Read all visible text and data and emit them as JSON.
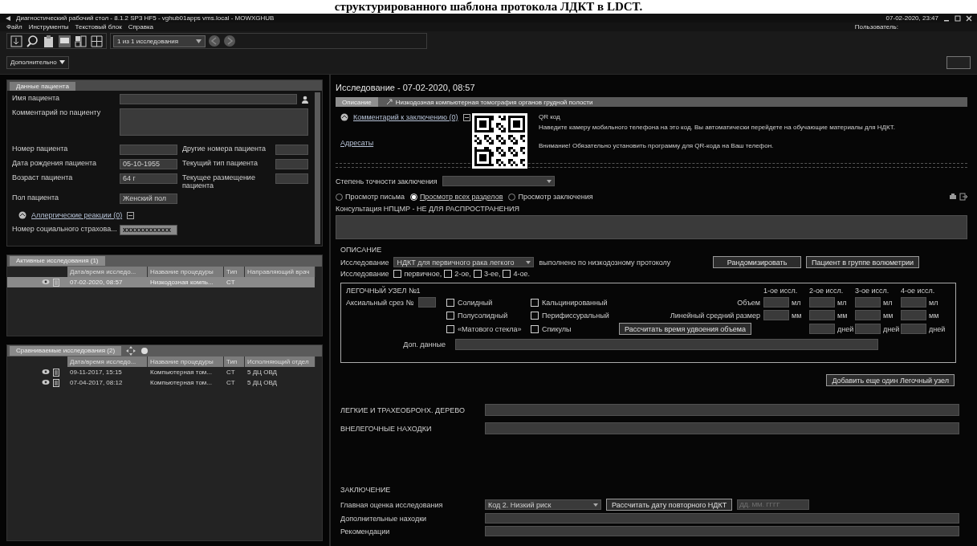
{
  "caption": "структурированного шаблона протокола ЛДКТ в LDCT.",
  "window": {
    "title": "Диагностический рабочий стол - 8.1.2 SP3 HF5 - vghub01apps vms.local - MOWXGHUB",
    "datetime": "07-02-2020, 23:47",
    "user_label": "Пользователь:"
  },
  "menu": [
    "Файл",
    "Инструменты",
    "Текстовый блок",
    "Справка"
  ],
  "toolbar": {
    "study_selector": "1 из 1 исследования",
    "more_button": "Дополнительно"
  },
  "patient": {
    "tab": "Данные пациента",
    "rows": [
      {
        "kind": "wide",
        "label": "Имя пациента"
      },
      {
        "kind": "tall",
        "label": "Комментарий по пациенту"
      },
      {
        "kind": "pair",
        "cells": [
          {
            "label": "Номер пациента"
          },
          {
            "label": "Другие номера пациента"
          }
        ]
      },
      {
        "kind": "pair",
        "cells": [
          {
            "label": "Дата рождения пациента",
            "value": "05-10-1955"
          },
          {
            "label": "Текущий тип пациента"
          }
        ]
      },
      {
        "kind": "pair",
        "cells": [
          {
            "label": "Возраст пациента",
            "value": "64 г"
          },
          {
            "label": "Текущее размещение пациента"
          }
        ]
      },
      {
        "kind": "single",
        "label": "Пол пациента",
        "value": "Женский пол"
      },
      {
        "kind": "link",
        "label": "Аллергические реакции (0)"
      },
      {
        "kind": "highlight",
        "label": "Номер социального страхова...",
        "value": "xxxxxxxxxxxx"
      }
    ]
  },
  "active_studies": {
    "title": "Активные исследования (1)",
    "columns": [
      "Дата/время исследо...",
      "Название процедуры",
      "Тип",
      "Направляющий врач"
    ],
    "rows": [
      {
        "selected": true,
        "cells": [
          "07-02-2020, 08:57",
          "Низкодозная компь...",
          "CT",
          ""
        ]
      }
    ]
  },
  "compared_studies": {
    "title": "Сравниваемые исследования (2)",
    "columns": [
      "Дата/время исследо...",
      "Название процедуры",
      "Тип",
      "Исполняющий отдел"
    ],
    "rows": [
      {
        "selected": false,
        "cells": [
          "09-11-2017, 15:15",
          "Компьютерная том...",
          "CT",
          "5 ДЦ ОВД"
        ]
      },
      {
        "selected": false,
        "cells": [
          "07-04-2017, 08:12",
          "Компьютерная том...",
          "CT",
          "5 ДЦ ОВД"
        ]
      }
    ]
  },
  "exam": {
    "title": "Исследование - 07-02-2020, 08:57",
    "tabs": [
      {
        "label": "Описание",
        "selected": true
      },
      {
        "label": "Низкодозная компьютерная томография органов грудной полости",
        "selected": false
      }
    ],
    "comment_link": "Комментарий к заключению (0)",
    "recipients_link": "Адресаты",
    "qr": {
      "title": "QR код",
      "text": "Наведите камеру мобильного телефона на это код. Вы автоматически перейдете на обучающие материалы для НДКТ.",
      "warning": "Внимание! Обязательно установить программу для QR-кода на Ваш телефон."
    },
    "accuracy_label": "Степень точности заключения",
    "view_options": [
      {
        "label": "Просмотр письма",
        "selected": false
      },
      {
        "label": "Просмотр всех разделов",
        "selected": true
      },
      {
        "label": "Просмотр заключения",
        "selected": false
      }
    ],
    "consult_label": "Консультация НПЦМР - НЕ ДЛЯ РАСПРОСТРАНЕНИЯ",
    "description": {
      "heading": "ОПИСАНИЕ",
      "study_label": "Исследование",
      "study_type": "НДКТ для первичного рака легкого",
      "protocol_text": "выполнено по низкодозному протоколу",
      "buttons": [
        "Рандомизировать",
        "Пациент в группе волюметрии"
      ],
      "order_label": "Исследование",
      "order_options": [
        {
          "label": "первичное,",
          "checked": false
        },
        {
          "label": "2-ое,",
          "checked": false
        },
        {
          "label": "3-ее,",
          "checked": false
        },
        {
          "label": "4-ое.",
          "checked": false
        }
      ]
    },
    "nodule": {
      "title": "ЛЕГОЧНЫЙ УЗЕЛ №1",
      "study_columns": [
        "1-ое иссл.",
        "2-ое иссл.",
        "3-ое иссл.",
        "4-ое иссл."
      ],
      "slice_label": "Аксиальный срез №",
      "types": [
        {
          "label": "Солидный",
          "checked": false
        },
        {
          "label": "Кальцинированный",
          "checked": false
        },
        {
          "label": "Полусолидный",
          "checked": false
        },
        {
          "label": "Перифиссуральный",
          "checked": false
        },
        {
          "label": "«Матового стекла»",
          "checked": false
        },
        {
          "label": "Спикулы",
          "checked": false
        }
      ],
      "volume_label": "Объем",
      "volume_units": [
        "мл",
        "мл",
        "мл",
        "мл"
      ],
      "size_label": "Линейный средний размер",
      "size_units": [
        "мм",
        "мм",
        "мм",
        "мм"
      ],
      "calc_button": "Рассчитать время удвоения объема",
      "days_units": [
        "дней",
        "дней",
        "дней"
      ],
      "extra_label": "Доп. данные"
    },
    "add_nodule_button": "Добавить еще один Легочный узел",
    "findings": [
      {
        "label": "ЛЕГКИЕ И ТРАХЕОБРОНХ. ДЕРЕВО"
      },
      {
        "label": "ВНЕЛЕГОЧНЫЕ НАХОДКИ"
      }
    ],
    "conclusion": {
      "heading": "ЗАКЛЮЧЕНИЕ",
      "main_label": "Главная оценка исследования",
      "main_value": "Код 2. Низкий риск",
      "calc_button": "Рассчитать дату повторного НДКТ",
      "date_placeholder": "ДД. ММ. ГГГГ",
      "extra_label": "Дополнительные находки",
      "recommend_label": "Рекомендации"
    }
  }
}
